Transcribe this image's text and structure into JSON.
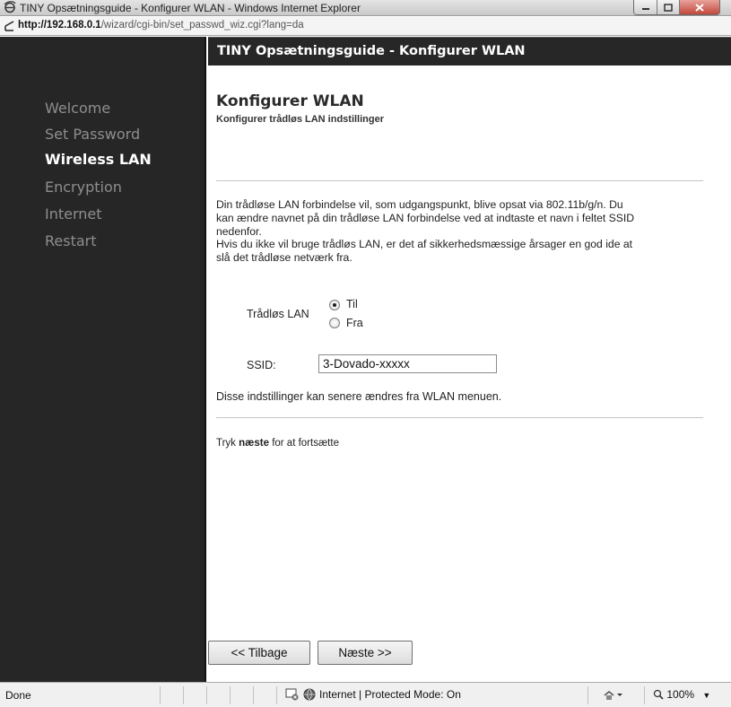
{
  "window": {
    "title": "TINY Opsætningsguide - Konfigurer WLAN - Windows Internet Explorer",
    "address_host": "http://192.168.0.1",
    "address_path": "/wizard/cgi-bin/set_passwd_wiz.cgi?lang=da"
  },
  "sidebar": {
    "items": [
      {
        "label": "Welcome"
      },
      {
        "label": "Set Password"
      },
      {
        "label": "Wireless LAN"
      },
      {
        "label": "Encryption"
      },
      {
        "label": "Internet"
      },
      {
        "label": "Restart"
      }
    ],
    "active_index": 2
  },
  "header": {
    "title": "TINY Opsætningsguide - Konfigurer WLAN"
  },
  "main": {
    "heading": "Konfigurer WLAN",
    "subtitle": "Konfigurer trådløs LAN indstillinger",
    "para1_lines": [
      "Din trådløse LAN forbindelse vil, som udgangspunkt, blive opsat via 802.11b/g/n. Du",
      "kan ændre navnet på din trådløse LAN forbindelse ved at indtaste et navn i feltet SSID",
      "nedenfor.",
      "Hvis du ikke vil bruge trådløs LAN, er det af sikkerhedsmæssige årsager en god ide at",
      "slå det trådløse netværk fra."
    ],
    "wlan_label": "Trådløs LAN",
    "radio_on_label": "Til",
    "radio_off_label": "Fra",
    "wlan_selected": "Til",
    "ssid_label": "SSID:",
    "ssid_value": "3-Dovado-xxxxx",
    "note": "Disse indstillinger kan senere ændres fra WLAN menuen.",
    "continue_prefix": "Tryk ",
    "continue_bold": "næste",
    "continue_suffix": " for at fortsætte",
    "back_button": "<< Tilbage",
    "next_button": "Næste >>"
  },
  "statusbar": {
    "status_text": "Done",
    "zone_text": "Internet | Protected Mode: On",
    "zoom_text": "100%"
  },
  "colors": {
    "sidebar_bg": "#262626",
    "sidebar_inactive": "#8e8e8e",
    "sidebar_active": "#ffffff",
    "header_bg": "#272727"
  }
}
